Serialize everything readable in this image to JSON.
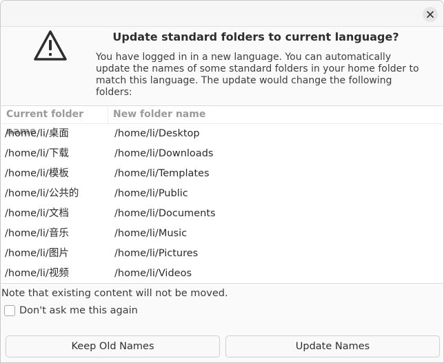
{
  "dialog": {
    "title": "Update standard folders to current language?",
    "description": "You have logged in in a new language. You can automatically update the names of some standard folders in your home folder to match this language. The update would change the following folders:",
    "close_icon": "close-icon",
    "warning_icon": "warning-triangle-icon"
  },
  "table": {
    "col_current": "Current folder name",
    "col_new": "New folder name",
    "rows": [
      {
        "current": "/home/li/桌面",
        "new": "/home/li/Desktop"
      },
      {
        "current": "/home/li/下载",
        "new": "/home/li/Downloads"
      },
      {
        "current": "/home/li/模板",
        "new": "/home/li/Templates"
      },
      {
        "current": "/home/li/公共的",
        "new": "/home/li/Public"
      },
      {
        "current": "/home/li/文档",
        "new": "/home/li/Documents"
      },
      {
        "current": "/home/li/音乐",
        "new": "/home/li/Music"
      },
      {
        "current": "/home/li/图片",
        "new": "/home/li/Pictures"
      },
      {
        "current": "/home/li/视频",
        "new": "/home/li/Videos"
      }
    ]
  },
  "note": "Note that existing content will not be moved.",
  "checkbox_label": "Don't ask me this again",
  "buttons": {
    "keep": "Keep Old Names",
    "update": "Update Names"
  }
}
